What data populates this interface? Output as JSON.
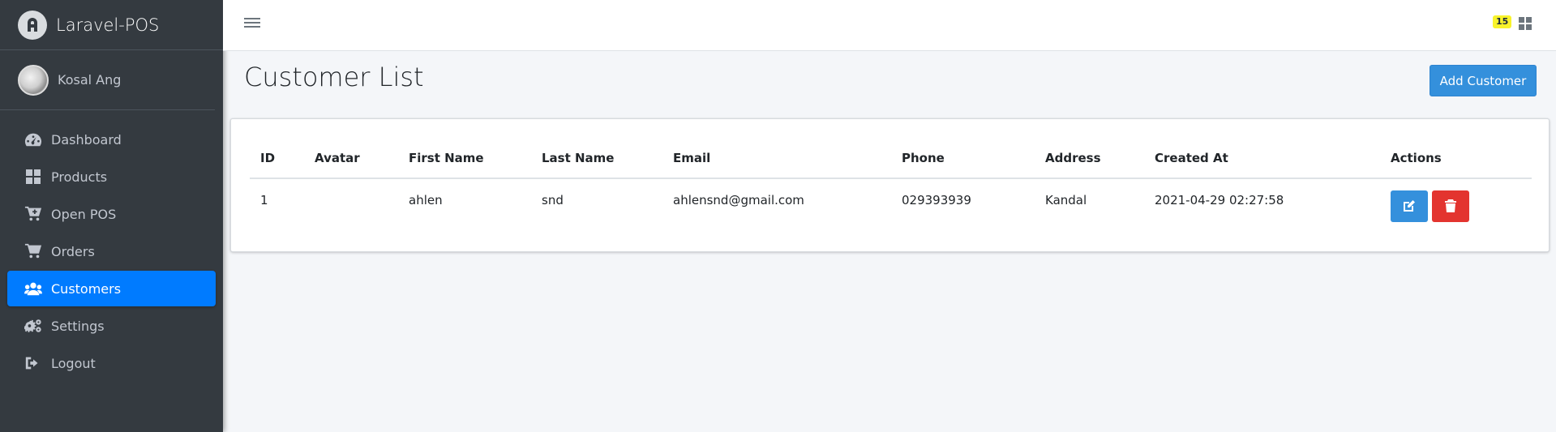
{
  "brand": {
    "name": "Laravel-POS",
    "logo_icon": "laravel-logo-icon"
  },
  "user": {
    "name": "Kosal Ang"
  },
  "sidebar": {
    "items": [
      {
        "label": "Dashboard",
        "icon": "dashboard-gauge-icon",
        "active": false
      },
      {
        "label": "Products",
        "icon": "grid-icon",
        "active": false
      },
      {
        "label": "Open POS",
        "icon": "cart-plus-icon",
        "active": false
      },
      {
        "label": "Orders",
        "icon": "cart-icon",
        "active": false
      },
      {
        "label": "Customers",
        "icon": "users-icon",
        "active": true
      },
      {
        "label": "Settings",
        "icon": "cogs-icon",
        "active": false
      },
      {
        "label": "Logout",
        "icon": "sign-out-icon",
        "active": false
      }
    ],
    "active_color": "#007bff"
  },
  "navbar": {
    "notification_count": "15"
  },
  "page": {
    "title": "Customer List",
    "add_button_label": "Add Customer"
  },
  "table": {
    "headers": [
      "ID",
      "Avatar",
      "First Name",
      "Last Name",
      "Email",
      "Phone",
      "Address",
      "Created At",
      "Actions"
    ],
    "rows": [
      {
        "id": "1",
        "avatar": "",
        "first_name": "ahlen",
        "last_name": "snd",
        "email": "ahlensnd@gmail.com",
        "phone": "029393939",
        "address": "Kandal",
        "created_at": "2021-04-29 02:27:58"
      }
    ]
  },
  "colors": {
    "primary": "#3490dc",
    "danger": "#e3342f",
    "sidebar_bg": "#343a40",
    "badge": "#f8f32b"
  }
}
